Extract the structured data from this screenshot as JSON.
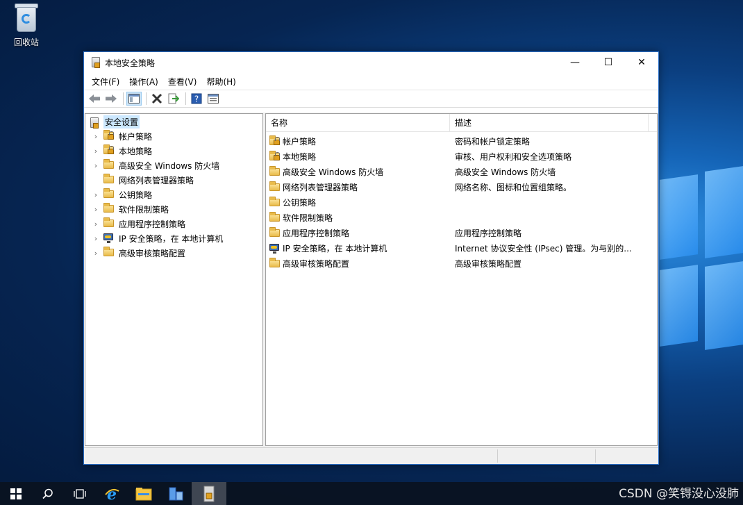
{
  "desktop": {
    "recycle_bin_label": "回收站"
  },
  "window": {
    "title": "本地安全策略",
    "controls": {
      "minimize": "—",
      "maximize": "☐",
      "close": "✕"
    }
  },
  "menu": [
    "文件(F)",
    "操作(A)",
    "查看(V)",
    "帮助(H)"
  ],
  "toolbar": [
    "back-icon",
    "forward-icon",
    "show-hide-tree-icon",
    "delete-icon",
    "export-list-icon",
    "help-icon",
    "properties-icon"
  ],
  "tree": {
    "root": "安全设置",
    "items": [
      {
        "label": "帐户策略",
        "icon": "folder-lock-icon",
        "expandable": true
      },
      {
        "label": "本地策略",
        "icon": "folder-lock-icon",
        "expandable": true
      },
      {
        "label": "高级安全 Windows 防火墙",
        "icon": "folder-icon",
        "expandable": true
      },
      {
        "label": "网络列表管理器策略",
        "icon": "folder-icon",
        "expandable": false
      },
      {
        "label": "公钥策略",
        "icon": "folder-icon",
        "expandable": true
      },
      {
        "label": "软件限制策略",
        "icon": "folder-icon",
        "expandable": true
      },
      {
        "label": "应用程序控制策略",
        "icon": "folder-icon",
        "expandable": true
      },
      {
        "label": "IP 安全策略，在 本地计算机",
        "icon": "ip-security-icon",
        "expandable": true
      },
      {
        "label": "高级审核策略配置",
        "icon": "folder-icon",
        "expandable": true
      }
    ]
  },
  "list": {
    "columns": [
      "名称",
      "描述"
    ],
    "rows": [
      {
        "name": "帐户策略",
        "desc": "密码和帐户锁定策略",
        "icon": "folder-lock-icon"
      },
      {
        "name": "本地策略",
        "desc": "审核、用户权利和安全选项策略",
        "icon": "folder-lock-icon"
      },
      {
        "name": "高级安全 Windows 防火墙",
        "desc": "高级安全 Windows 防火墙",
        "icon": "folder-icon"
      },
      {
        "name": "网络列表管理器策略",
        "desc": "网络名称、图标和位置组策略。",
        "icon": "folder-icon"
      },
      {
        "name": "公钥策略",
        "desc": "",
        "icon": "folder-icon"
      },
      {
        "name": "软件限制策略",
        "desc": "",
        "icon": "folder-icon"
      },
      {
        "name": "应用程序控制策略",
        "desc": "应用程序控制策略",
        "icon": "folder-icon"
      },
      {
        "name": "IP 安全策略，在 本地计算机",
        "desc": "Internet 协议安全性 (IPsec) 管理。为与别的...",
        "icon": "ip-security-icon"
      },
      {
        "name": "高级审核策略配置",
        "desc": "高级审核策略配置",
        "icon": "folder-icon"
      }
    ]
  },
  "taskbar": [
    "start-icon",
    "search-icon",
    "task-view-icon",
    "internet-explorer-icon",
    "file-explorer-icon",
    "server-manager-icon",
    "local-security-policy-icon"
  ],
  "watermark": "CSDN @笑锝没心没肺"
}
